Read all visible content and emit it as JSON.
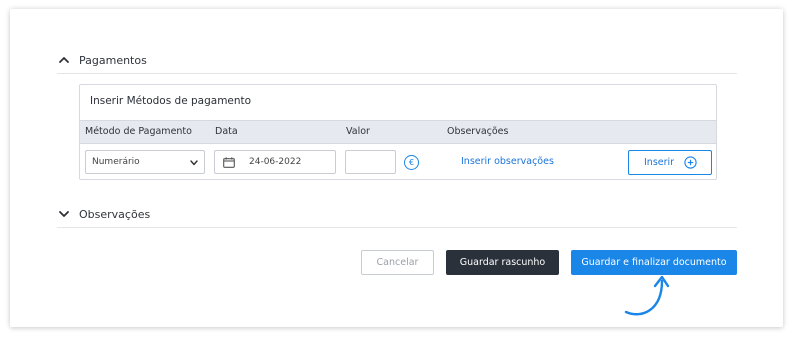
{
  "sections": {
    "payments_title": "Pagamentos",
    "observations_title": "Observações"
  },
  "panel": {
    "title": "Inserir Métodos de pagamento",
    "columns": [
      "Método de Pagamento",
      "Data",
      "Valor",
      "Observações"
    ],
    "row": {
      "method_selected": "Numerário",
      "date_value": "24-06-2022",
      "amount_value": "",
      "currency_symbol": "€",
      "observations_link": "Inserir observações",
      "insert_label": "Inserir"
    }
  },
  "actions": {
    "cancel_label": "Cancelar",
    "draft_label": "Guardar rascunho",
    "finalize_label": "Guardar e finalizar documento"
  },
  "colors": {
    "accent": "#1a86e8",
    "dark_button": "#2b313b",
    "table_header": "#e6e9ef"
  }
}
